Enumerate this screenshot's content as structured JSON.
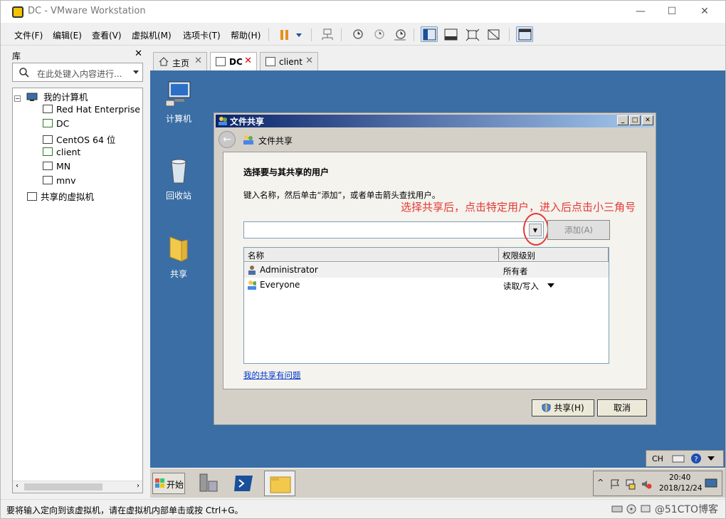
{
  "window": {
    "title": "DC - VMware Workstation",
    "minimize": "—",
    "maximize": "☐",
    "close": "✕"
  },
  "menu": [
    "文件(F)",
    "编辑(E)",
    "查看(V)",
    "虚拟机(M)",
    "选项卡(T)",
    "帮助(H)"
  ],
  "library": {
    "header": "库",
    "close": "✕",
    "search_placeholder": "在此处键入内容进行...",
    "root": "我的计算机",
    "vms": [
      "Red Hat Enterprise L",
      "DC",
      "CentOS 64 位",
      "client",
      "MN",
      "mnv"
    ],
    "shared": "共享的虚拟机"
  },
  "tabs": [
    {
      "label": "主页",
      "close": "✕"
    },
    {
      "label": "DC",
      "close": "✕"
    },
    {
      "label": "client",
      "close": "✕"
    }
  ],
  "desktop_icons": [
    "计算机",
    "回收站",
    "共享"
  ],
  "dialog": {
    "caption": "文件共享",
    "nav_title": "文件共享",
    "heading": "选择要与其共享的用户",
    "instruction": "键入名称，然后单击“添加”，或者单击箭头查找用户。",
    "annotation": "选择共享后，点击特定用户，进入后点击小三角号",
    "add_button": "添加(A)",
    "columns": [
      "名称",
      "权限级别"
    ],
    "rows": [
      {
        "name": "Administrator",
        "level": "所有者"
      },
      {
        "name": "Everyone",
        "level": "读取/写入"
      }
    ],
    "help_link": "我的共享有问题",
    "share_button": "共享(H)",
    "cancel_button": "取消"
  },
  "taskbar": {
    "start": "开始",
    "lang": "CH",
    "time": "20:40",
    "date": "2018/12/24"
  },
  "status": {
    "message": "要将输入定向到该虚拟机，请在虚拟机内部单击或按 Ctrl+G。",
    "watermark": "@51CTO博客"
  }
}
